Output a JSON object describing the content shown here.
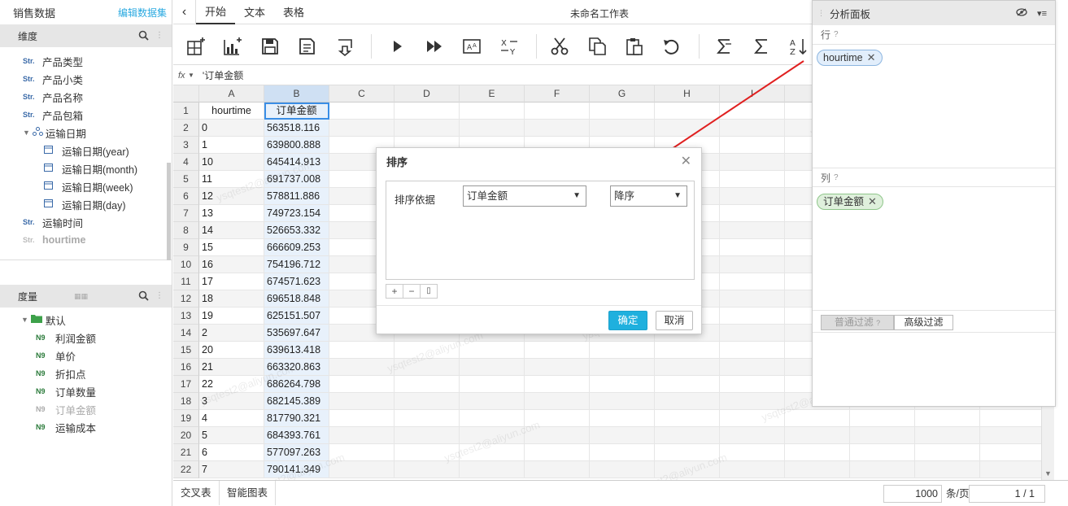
{
  "left_panel": {
    "dataset_name": "销售数据",
    "edit_link": "编辑数据集",
    "dimensions_title": "维度",
    "dimensions": [
      {
        "tag": "Str.",
        "label": "产品类型"
      },
      {
        "tag": "Str.",
        "label": "产品小类"
      },
      {
        "tag": "Str.",
        "label": "产品名称"
      },
      {
        "tag": "Str.",
        "label": "产品包箱"
      }
    ],
    "date_group": "运输日期",
    "date_children": [
      "运输日期(year)",
      "运输日期(month)",
      "运输日期(week)",
      "运输日期(day)"
    ],
    "dimension_tail": [
      {
        "tag": "Str.",
        "label": "运输时间"
      },
      {
        "tag": "Str.",
        "label": "hourtime"
      }
    ],
    "measures_title": "度量",
    "measure_folder": "默认",
    "measures": [
      {
        "tag": "N9",
        "label": "利润金额"
      },
      {
        "tag": "N9",
        "label": "单价"
      },
      {
        "tag": "N9",
        "label": "折扣点"
      },
      {
        "tag": "N9",
        "label": "订单数量"
      },
      {
        "tag": "N9",
        "label": "订单金额"
      },
      {
        "tag": "N9",
        "label": "运输成本"
      }
    ]
  },
  "toolbar": {
    "back": "‹",
    "tabs": [
      "开始",
      "文本",
      "表格"
    ],
    "sheet_title": "未命名工作表"
  },
  "formula_bar": {
    "fx": "fx",
    "value": "'订单金额"
  },
  "grid": {
    "columns": [
      "A",
      "B",
      "C",
      "D",
      "E",
      "F",
      "G",
      "H",
      "I"
    ],
    "rows": [
      [
        "1",
        "hourtime",
        "订单金额"
      ],
      [
        "2",
        "0",
        "563518.116"
      ],
      [
        "3",
        "1",
        "639800.888"
      ],
      [
        "4",
        "10",
        "645414.913"
      ],
      [
        "5",
        "11",
        "691737.008"
      ],
      [
        "6",
        "12",
        "578811.886"
      ],
      [
        "7",
        "13",
        "749723.154"
      ],
      [
        "8",
        "14",
        "526653.332"
      ],
      [
        "9",
        "15",
        "666609.253"
      ],
      [
        "10",
        "16",
        "754196.712"
      ],
      [
        "11",
        "17",
        "674571.623"
      ],
      [
        "12",
        "18",
        "696518.848"
      ],
      [
        "13",
        "19",
        "625151.507"
      ],
      [
        "14",
        "2",
        "535697.647"
      ],
      [
        "15",
        "20",
        "639613.418"
      ],
      [
        "16",
        "21",
        "663320.863"
      ],
      [
        "17",
        "22",
        "686264.798"
      ],
      [
        "18",
        "3",
        "682145.389"
      ],
      [
        "19",
        "4",
        "817790.321"
      ],
      [
        "20",
        "5",
        "684393.761"
      ],
      [
        "21",
        "6",
        "577097.263"
      ],
      [
        "22",
        "7",
        "790141.349"
      ]
    ],
    "watermark": "ysqtest2@aliyun.com"
  },
  "bottom_bar": {
    "tabs": [
      "交叉表",
      "智能图表"
    ],
    "page_size": "1000",
    "page_size_unit": "条/页",
    "page_indicator": "1 / 1"
  },
  "analysis_panel": {
    "title": "分析面板",
    "rows_label": "行",
    "row_fields": [
      "hourtime"
    ],
    "cols_label": "列",
    "col_fields": [
      "订单金额"
    ],
    "filter_tabs": [
      "普通过滤",
      "高级过滤"
    ]
  },
  "sort_dialog": {
    "title": "排序",
    "sort_by_label": "排序依据",
    "sort_field": "订单金额",
    "sort_order": "降序",
    "confirm": "确定",
    "cancel": "取消"
  },
  "colors": {
    "accent": "#1fb0de",
    "arrow": "#e02020",
    "selected_column": "#e8f1fb"
  }
}
